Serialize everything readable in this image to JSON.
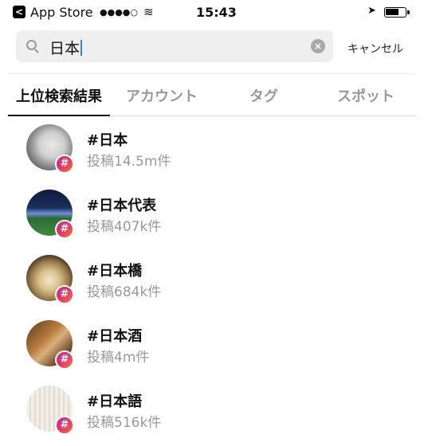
{
  "status_bar": {
    "back_glyph": "<",
    "carrier": "App Store",
    "signal": "●●●●○",
    "wifi_glyph": "≋",
    "time": "15:43",
    "location_glyph": "➤"
  },
  "search": {
    "value": "日本",
    "clear_glyph": "×",
    "cancel_label": "キャンセル"
  },
  "tabs": [
    {
      "label": "上位検索結果",
      "active": true
    },
    {
      "label": "アカウント",
      "active": false
    },
    {
      "label": "タグ",
      "active": false
    },
    {
      "label": "スポット",
      "active": false
    }
  ],
  "results": [
    {
      "tag": "#日本",
      "count": "投稿14.5m件",
      "badge": "#"
    },
    {
      "tag": "#日本代表",
      "count": "投稿407k件",
      "badge": "#"
    },
    {
      "tag": "#日本橋",
      "count": "投稿684k件",
      "badge": "#"
    },
    {
      "tag": "#日本酒",
      "count": "投稿4m件",
      "badge": "#"
    },
    {
      "tag": "#日本語",
      "count": "投稿516k件",
      "badge": "#"
    }
  ],
  "colors": {
    "active_tab": "#111111",
    "inactive_tab": "#999999",
    "badge_gradient_start": "#c13584",
    "badge_gradient_end": "#f77737"
  }
}
